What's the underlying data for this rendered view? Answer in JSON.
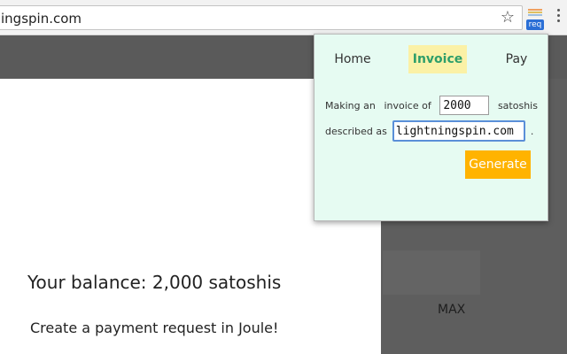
{
  "browser": {
    "url": "ingspin.com",
    "star_icon": "star-icon",
    "extension_badge": "req",
    "menu_icon": "vertical-dots-icon"
  },
  "page": {
    "balance": "Your balance: 2,000 satoshis",
    "create_text": "Create a payment request in Joule!",
    "max_label": "MAX"
  },
  "popup": {
    "tabs": {
      "home": "Home",
      "invoice": "Invoice",
      "pay": "Pay"
    },
    "form": {
      "making_an": "Making an",
      "invoice_of": "invoice of",
      "amount": "2000",
      "satoshis": "satoshis",
      "described_as": "described as",
      "description": "lightningspin.com",
      "period": "."
    },
    "generate_label": "Generate"
  },
  "colors": {
    "popup_bg": "#e6fbf2",
    "active_tab_bg": "#fbf1a6",
    "active_tab_text": "#2e9e6a",
    "generate_bg": "#ffb300",
    "page_dark": "#5a5a5a"
  }
}
